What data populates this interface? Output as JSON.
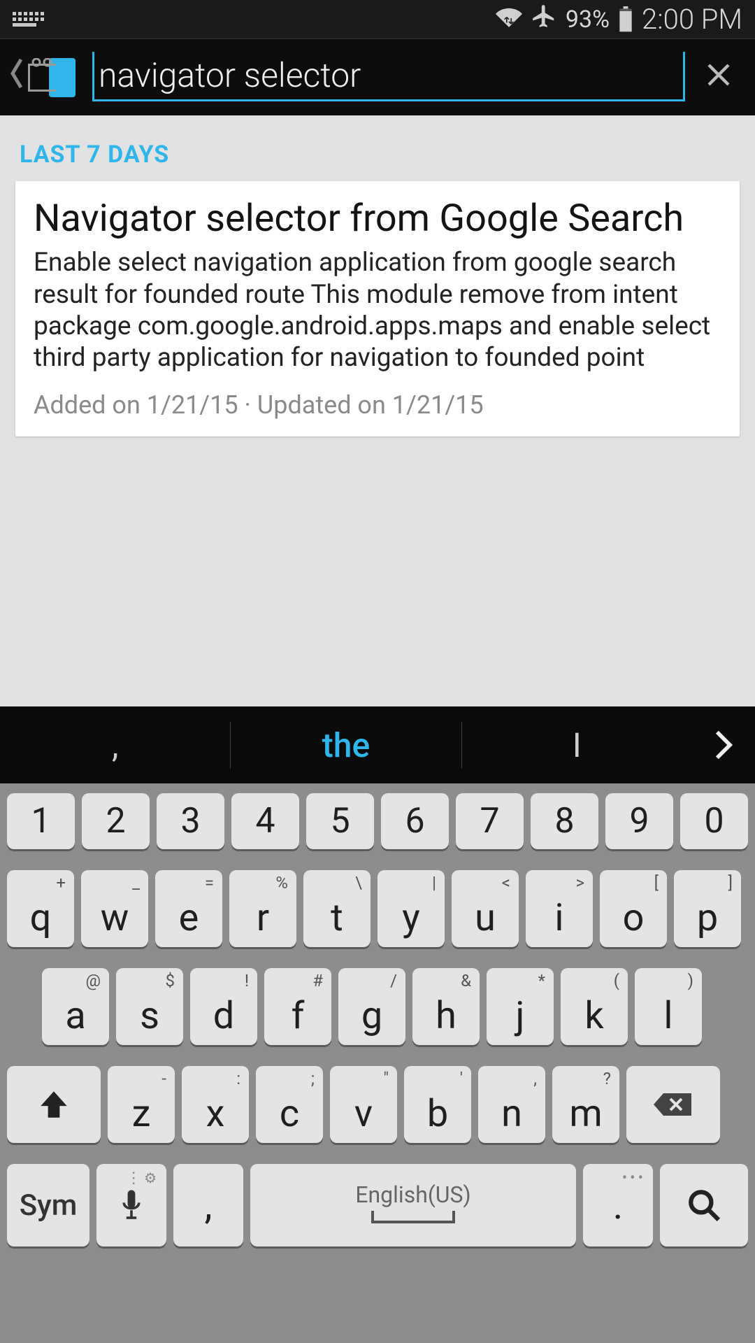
{
  "status": {
    "battery_pct": "93%",
    "time": "2:00 PM"
  },
  "actionbar": {
    "search_value": "navigator selector"
  },
  "content": {
    "section_header": "LAST 7 DAYS",
    "card": {
      "title": "Navigator selector from Google Search",
      "description": "Enable select navigation application from google search result for founded route This module remove from intent package com.google.android.apps.maps and enable select third party application for navigation to founded point",
      "meta": "Added on 1/21/15 · Updated on 1/21/15"
    }
  },
  "suggestions": {
    "left": ",",
    "center": "the",
    "right": "I"
  },
  "keyboard": {
    "numbers": [
      "1",
      "2",
      "3",
      "4",
      "5",
      "6",
      "7",
      "8",
      "9",
      "0"
    ],
    "row1": [
      {
        "m": "q",
        "s": "+"
      },
      {
        "m": "w",
        "s": "_"
      },
      {
        "m": "e",
        "s": "="
      },
      {
        "m": "r",
        "s": "%"
      },
      {
        "m": "t",
        "s": "\\"
      },
      {
        "m": "y",
        "s": "|"
      },
      {
        "m": "u",
        "s": "<"
      },
      {
        "m": "i",
        "s": ">"
      },
      {
        "m": "o",
        "s": "["
      },
      {
        "m": "p",
        "s": "]"
      }
    ],
    "row2": [
      {
        "m": "a",
        "s": "@"
      },
      {
        "m": "s",
        "s": "$"
      },
      {
        "m": "d",
        "s": "!"
      },
      {
        "m": "f",
        "s": "#"
      },
      {
        "m": "g",
        "s": "/"
      },
      {
        "m": "h",
        "s": "&"
      },
      {
        "m": "j",
        "s": "*"
      },
      {
        "m": "k",
        "s": "("
      },
      {
        "m": "l",
        "s": ")"
      }
    ],
    "row3": [
      {
        "m": "z",
        "s": "-"
      },
      {
        "m": "x",
        "s": ":"
      },
      {
        "m": "c",
        "s": ";"
      },
      {
        "m": "v",
        "s": "\""
      },
      {
        "m": "b",
        "s": "'"
      },
      {
        "m": "n",
        "s": ","
      },
      {
        "m": "m",
        "s": "?"
      }
    ],
    "sym_label": "Sym",
    "space_label": "English(US)"
  }
}
